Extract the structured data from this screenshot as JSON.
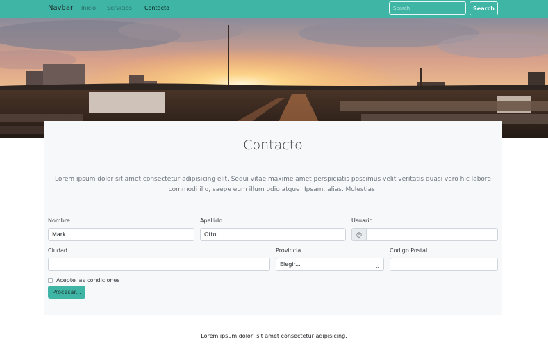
{
  "navbar": {
    "brand": "Navbar",
    "links": [
      "Inicio",
      "Servicios",
      "Contacto"
    ],
    "search_placeholder": "Search",
    "search_button": "Search"
  },
  "contact": {
    "title": "Contacto",
    "intro": "Lorem ipsum dolor sit amet consectetur adipisicing elit. Sequi vitae maxime amet perspiciatis possimus velit veritatis quasi vero hic labore commodi illo, saepe eum illum odio atque! Ipsam, alias. Molestias!",
    "form": {
      "nombre_label": "Nombre",
      "nombre_value": "Mark",
      "apellido_label": "Apellido",
      "apellido_value": "Otto",
      "usuario_label": "Usuario",
      "usuario_prefix": "@",
      "usuario_value": "",
      "ciudad_label": "Ciudad",
      "ciudad_value": "",
      "provincia_label": "Provincia",
      "provincia_selected": "Elegir...",
      "cp_label": "Codigo Postal",
      "cp_value": "",
      "terms_label": "Acepte las condiciones",
      "terms_checked": false,
      "submit_label": "Procesar..."
    }
  },
  "footer": {
    "text": "Lorem ipsum dolor, sit amet consectetur adipisicing."
  },
  "colors": {
    "accent": "#3fb5a6",
    "card_bg": "#f7f8fa"
  },
  "icons": {
    "select_caret": "chevron-down-icon"
  }
}
